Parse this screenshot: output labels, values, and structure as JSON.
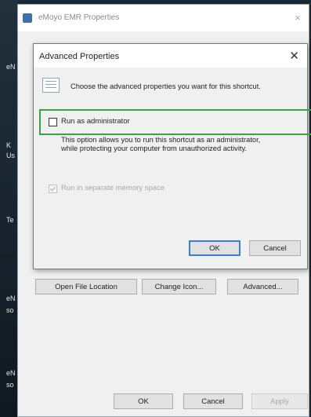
{
  "desktop": {
    "fragments": [
      "eN",
      "K",
      "Us",
      "Te",
      "eN",
      "so",
      "eN",
      "so"
    ]
  },
  "properties_window": {
    "title": "eMoyo EMR Properties",
    "close_glyph": "×",
    "buttons": {
      "open_file_location": "Open File Location",
      "change_icon": "Change Icon...",
      "advanced": "Advanced..."
    },
    "footer": {
      "ok": "OK",
      "cancel": "Cancel",
      "apply": "Apply"
    }
  },
  "advanced_dialog": {
    "title": "Advanced Properties",
    "close_glyph": "✕",
    "intro": "Choose the advanced properties you want for this shortcut.",
    "run_as_admin": {
      "label": "Run as administrator",
      "checked": false
    },
    "description": "This option allows you to run this shortcut as an administrator, while protecting your computer from unauthorized activity.",
    "separate_memory": {
      "label": "Run in separate memory space",
      "checked": true,
      "disabled": true
    },
    "ok": "OK",
    "cancel": "Cancel"
  },
  "colors": {
    "highlight": "#3aa147",
    "focus": "#3c7fd1"
  }
}
